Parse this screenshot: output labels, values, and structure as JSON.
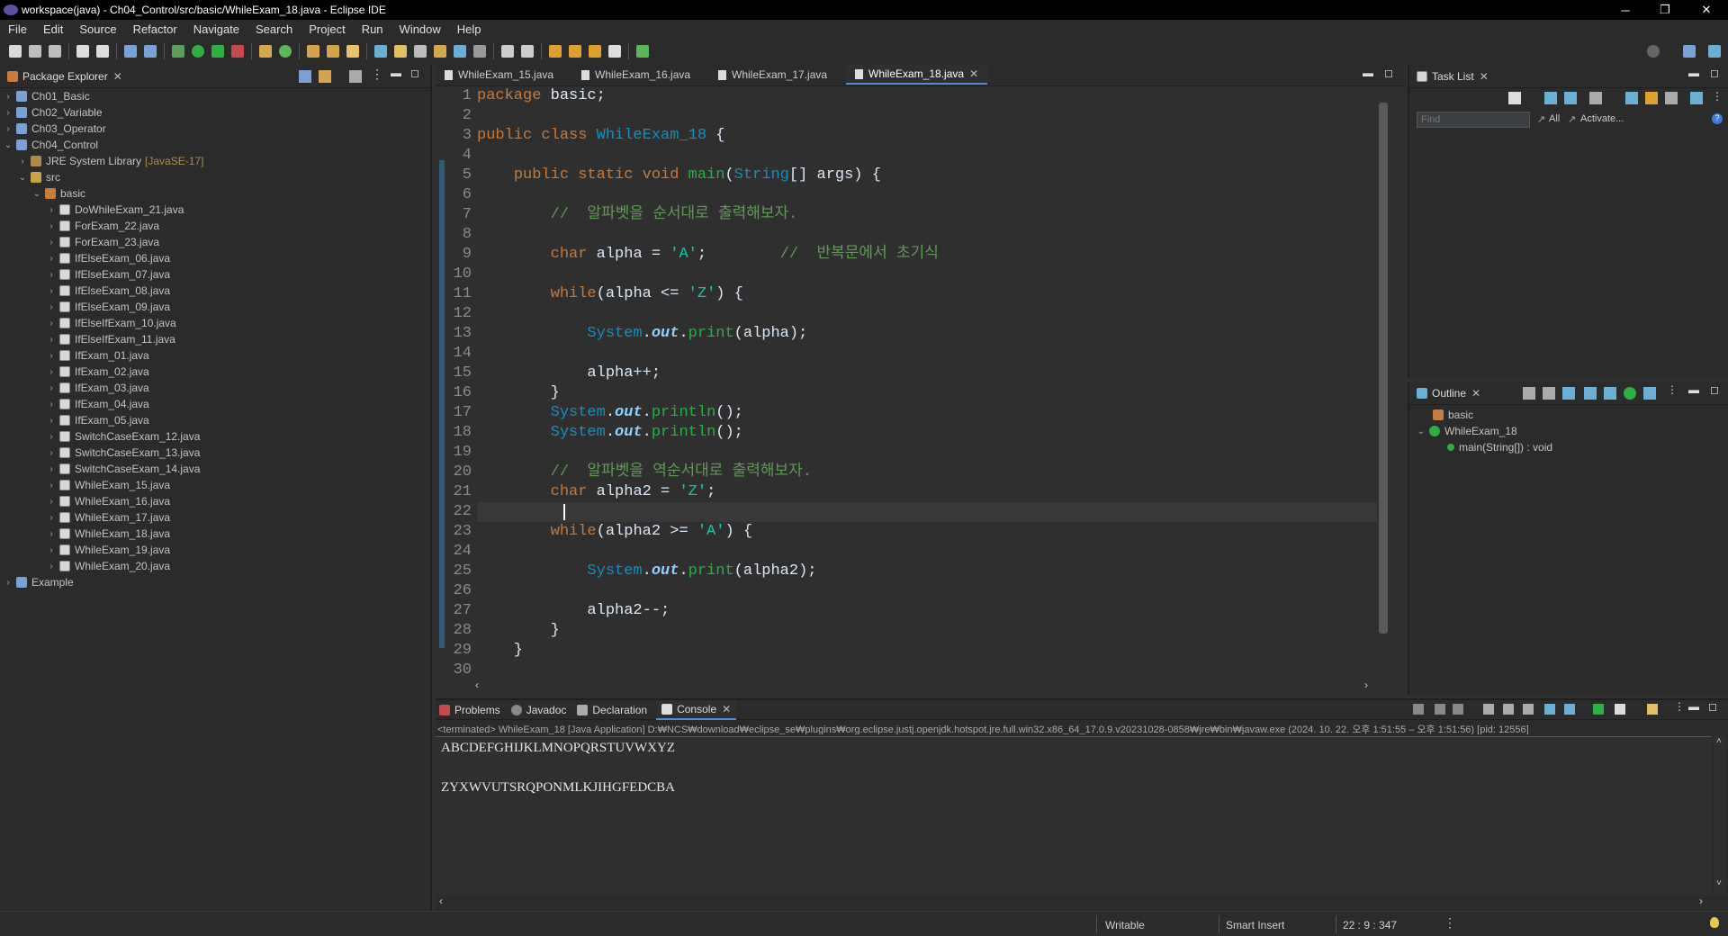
{
  "window": {
    "title": "workspace(java) - Ch04_Control/src/basic/WhileExam_18.java - Eclipse IDE",
    "minimize": "─",
    "maximize": "❐",
    "close": "✕"
  },
  "menu": [
    "File",
    "Edit",
    "Source",
    "Refactor",
    "Navigate",
    "Search",
    "Project",
    "Run",
    "Window",
    "Help"
  ],
  "package_explorer": {
    "title": "Package Explorer",
    "items": [
      {
        "label": "Ch01_Basic",
        "indent": 0,
        "twisty": "›",
        "icon": "project"
      },
      {
        "label": "Ch02_Variable",
        "indent": 0,
        "twisty": "›",
        "icon": "project"
      },
      {
        "label": "Ch03_Operator",
        "indent": 0,
        "twisty": "›",
        "icon": "project"
      },
      {
        "label": "Ch04_Control",
        "indent": 0,
        "twisty": "⌄",
        "icon": "project"
      },
      {
        "label": "JRE System Library",
        "suffix": "[JavaSE-17]",
        "indent": 1,
        "twisty": "›",
        "icon": "jre"
      },
      {
        "label": "src",
        "indent": 1,
        "twisty": "⌄",
        "icon": "src"
      },
      {
        "label": "basic",
        "indent": 2,
        "twisty": "⌄",
        "icon": "package"
      },
      {
        "label": "DoWhileExam_21.java",
        "indent": 3,
        "twisty": "›",
        "icon": "file"
      },
      {
        "label": "ForExam_22.java",
        "indent": 3,
        "twisty": "›",
        "icon": "file"
      },
      {
        "label": "ForExam_23.java",
        "indent": 3,
        "twisty": "›",
        "icon": "file"
      },
      {
        "label": "IfElseExam_06.java",
        "indent": 3,
        "twisty": "›",
        "icon": "file"
      },
      {
        "label": "IfElseExam_07.java",
        "indent": 3,
        "twisty": "›",
        "icon": "file"
      },
      {
        "label": "IfElseExam_08.java",
        "indent": 3,
        "twisty": "›",
        "icon": "file"
      },
      {
        "label": "IfElseExam_09.java",
        "indent": 3,
        "twisty": "›",
        "icon": "file"
      },
      {
        "label": "IfElseIfExam_10.java",
        "indent": 3,
        "twisty": "›",
        "icon": "file"
      },
      {
        "label": "IfElseIfExam_11.java",
        "indent": 3,
        "twisty": "›",
        "icon": "file"
      },
      {
        "label": "IfExam_01.java",
        "indent": 3,
        "twisty": "›",
        "icon": "file"
      },
      {
        "label": "IfExam_02.java",
        "indent": 3,
        "twisty": "›",
        "icon": "file"
      },
      {
        "label": "IfExam_03.java",
        "indent": 3,
        "twisty": "›",
        "icon": "file"
      },
      {
        "label": "IfExam_04.java",
        "indent": 3,
        "twisty": "›",
        "icon": "file"
      },
      {
        "label": "IfExam_05.java",
        "indent": 3,
        "twisty": "›",
        "icon": "file"
      },
      {
        "label": "SwitchCaseExam_12.java",
        "indent": 3,
        "twisty": "›",
        "icon": "file"
      },
      {
        "label": "SwitchCaseExam_13.java",
        "indent": 3,
        "twisty": "›",
        "icon": "file"
      },
      {
        "label": "SwitchCaseExam_14.java",
        "indent": 3,
        "twisty": "›",
        "icon": "file"
      },
      {
        "label": "WhileExam_15.java",
        "indent": 3,
        "twisty": "›",
        "icon": "file"
      },
      {
        "label": "WhileExam_16.java",
        "indent": 3,
        "twisty": "›",
        "icon": "file"
      },
      {
        "label": "WhileExam_17.java",
        "indent": 3,
        "twisty": "›",
        "icon": "file"
      },
      {
        "label": "WhileExam_18.java",
        "indent": 3,
        "twisty": "›",
        "icon": "file"
      },
      {
        "label": "WhileExam_19.java",
        "indent": 3,
        "twisty": "›",
        "icon": "file"
      },
      {
        "label": "WhileExam_20.java",
        "indent": 3,
        "twisty": "›",
        "icon": "file"
      },
      {
        "label": "Example",
        "indent": 0,
        "twisty": "›",
        "icon": "project"
      }
    ]
  },
  "editor_tabs": [
    "WhileExam_15.java",
    "WhileExam_16.java",
    "WhileExam_17.java",
    "WhileExam_18.java"
  ],
  "active_tab": "WhileExam_18.java",
  "code_lines": [
    [
      [
        "kw",
        "package"
      ],
      [
        "pl",
        " basic;"
      ]
    ],
    [],
    [
      [
        "kw",
        "public class "
      ],
      [
        "cls",
        "WhileExam_18"
      ],
      [
        "pl",
        " {"
      ]
    ],
    [],
    [
      [
        "pl",
        "    "
      ],
      [
        "kw",
        "public static void "
      ],
      [
        "mth",
        "main"
      ],
      [
        "pl",
        "("
      ],
      [
        "cls",
        "String"
      ],
      [
        "pl",
        "[] "
      ],
      [
        "pl",
        "args) {"
      ]
    ],
    [],
    [
      [
        "pl",
        "        "
      ],
      [
        "cmt",
        "//  알파벳을 순서대로 출력해보자."
      ]
    ],
    [],
    [
      [
        "pl",
        "        "
      ],
      [
        "kw",
        "char "
      ],
      [
        "pl",
        "alpha = "
      ],
      [
        "str",
        "'A'"
      ],
      [
        "pl",
        ";        "
      ],
      [
        "cmt",
        "//  반복문에서 초기식"
      ]
    ],
    [],
    [
      [
        "pl",
        "        "
      ],
      [
        "kw",
        "while"
      ],
      [
        "pl",
        "(alpha <= "
      ],
      [
        "str",
        "'Z'"
      ],
      [
        "pl",
        ") {"
      ]
    ],
    [],
    [
      [
        "pl",
        "            "
      ],
      [
        "cls",
        "System"
      ],
      [
        "pl",
        "."
      ],
      [
        "fld",
        "out"
      ],
      [
        "pl",
        "."
      ],
      [
        "mth",
        "print"
      ],
      [
        "pl",
        "(alpha);"
      ]
    ],
    [],
    [
      [
        "pl",
        "            alpha++;"
      ]
    ],
    [
      [
        "pl",
        "        }"
      ]
    ],
    [
      [
        "pl",
        "        "
      ],
      [
        "cls",
        "System"
      ],
      [
        "pl",
        "."
      ],
      [
        "fld",
        "out"
      ],
      [
        "pl",
        "."
      ],
      [
        "mth",
        "println"
      ],
      [
        "pl",
        "();"
      ]
    ],
    [
      [
        "pl",
        "        "
      ],
      [
        "cls",
        "System"
      ],
      [
        "pl",
        "."
      ],
      [
        "fld",
        "out"
      ],
      [
        "pl",
        "."
      ],
      [
        "mth",
        "println"
      ],
      [
        "pl",
        "();"
      ]
    ],
    [],
    [
      [
        "pl",
        "        "
      ],
      [
        "cmt",
        "//  알파벳을 역순서대로 출력해보자."
      ]
    ],
    [
      [
        "pl",
        "        "
      ],
      [
        "kw",
        "char "
      ],
      [
        "pl",
        "alpha2 = "
      ],
      [
        "str",
        "'Z'"
      ],
      [
        "pl",
        ";"
      ]
    ],
    [
      [
        "pl",
        "        "
      ]
    ],
    [
      [
        "pl",
        "        "
      ],
      [
        "kw",
        "while"
      ],
      [
        "pl",
        "(alpha2 >= "
      ],
      [
        "str",
        "'A'"
      ],
      [
        "pl",
        ") {"
      ]
    ],
    [],
    [
      [
        "pl",
        "            "
      ],
      [
        "cls",
        "System"
      ],
      [
        "pl",
        "."
      ],
      [
        "fld",
        "out"
      ],
      [
        "pl",
        "."
      ],
      [
        "mth",
        "print"
      ],
      [
        "pl",
        "(alpha2);"
      ]
    ],
    [],
    [
      [
        "pl",
        "            alpha2--;"
      ]
    ],
    [
      [
        "pl",
        "        }"
      ]
    ],
    [
      [
        "pl",
        "    }"
      ]
    ],
    []
  ],
  "task_list": {
    "title": "Task List",
    "find_placeholder": "Find",
    "all": "All",
    "activate": "Activate..."
  },
  "outline": {
    "title": "Outline",
    "items": [
      {
        "label": "basic",
        "icon": "package"
      },
      {
        "label": "WhileExam_18",
        "icon": "class"
      },
      {
        "label": "main(String[]) : void",
        "icon": "method"
      }
    ]
  },
  "bottom_tabs": [
    "Problems",
    "Javadoc",
    "Declaration",
    "Console"
  ],
  "active_bottom_tab": "Console",
  "console": {
    "header": "<terminated> WhileExam_18 [Java Application] D:₩NCS₩download₩eclipse_se₩plugins₩org.eclipse.justj.openjdk.hotspot.jre.full.win32.x86_64_17.0.9.v20231028-0858₩jre₩bin₩javaw.exe  (2024. 10. 22. 오후 1:51:55 – 오후 1:51:56) [pid: 12556]",
    "output": [
      "ABCDEFGHIJKLMNOPQRSTUVWXYZ",
      "",
      "ZYXWVUTSRQPONMLKJIHGFEDCBA"
    ]
  },
  "status": {
    "writable": "Writable",
    "insert": "Smart Insert",
    "position": "22 : 9 : 347"
  },
  "colors": {
    "keyword": "#cc7832",
    "class": "#1290c3",
    "method": "#1eb540",
    "comment": "#5f9b55",
    "string": "#17c6a3"
  }
}
